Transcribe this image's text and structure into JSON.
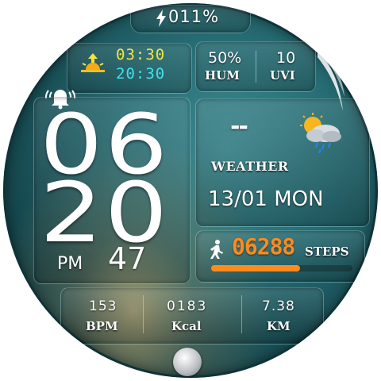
{
  "battery": {
    "icon": "bolt-icon",
    "value": "011%"
  },
  "sun": {
    "icon": "sunrise-icon",
    "sunrise": "03:30",
    "sunset": "20:30",
    "sunrise_color": "#f4e43a",
    "sunset_color": "#42e0e8"
  },
  "humidity": {
    "value": "50%",
    "label": "HUM"
  },
  "uv": {
    "value": "10",
    "label": "UVI"
  },
  "alarm": {
    "icon": "alarm-bell-icon"
  },
  "time": {
    "hour": "06",
    "minute": "20",
    "ampm": "PM",
    "seconds": "47"
  },
  "weather": {
    "temp": "--",
    "label": "WEATHER",
    "icon": "cloud-sun-rain-icon"
  },
  "date": {
    "text": "13/01 MON"
  },
  "steps": {
    "icon": "walking-person-icon",
    "value": "06288",
    "label": "STEPS",
    "value_color": "#ff8a1e",
    "progress": 0.63
  },
  "stats": [
    {
      "value": "153",
      "label": "BPM"
    },
    {
      "value": "0183",
      "label": "Kcal"
    },
    {
      "value": "7.38",
      "label": "KM"
    }
  ]
}
